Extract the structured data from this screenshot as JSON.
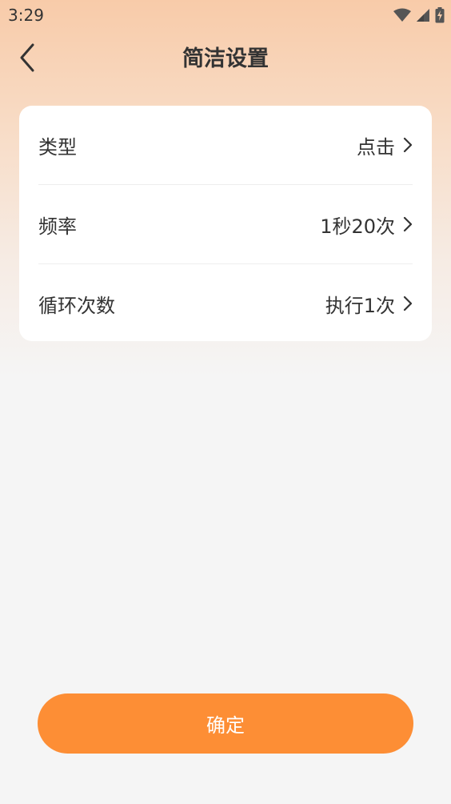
{
  "status_bar": {
    "time": "3:29",
    "icons": [
      "wifi-icon",
      "cell-signal-icon",
      "battery-charging-icon"
    ]
  },
  "header": {
    "back_icon": "chevron-left-icon",
    "title": "简洁设置"
  },
  "settings": {
    "items": [
      {
        "label": "类型",
        "value": "点击"
      },
      {
        "label": "频率",
        "value": "1秒20次"
      },
      {
        "label": "循环次数",
        "value": "执行1次"
      }
    ]
  },
  "footer": {
    "confirm_label": "确定"
  },
  "colors": {
    "accent": "#fd8e35",
    "header_gradient_top": "#f8cba9",
    "background": "#f5f5f5",
    "card": "#ffffff"
  }
}
